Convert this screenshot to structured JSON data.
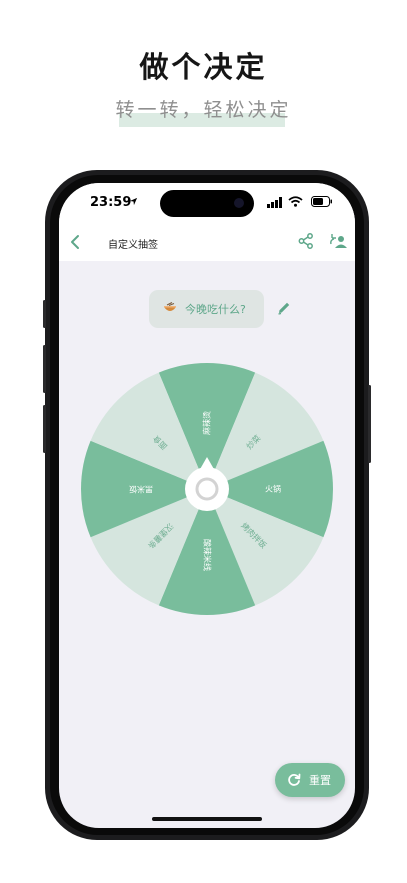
{
  "promo": {
    "headline": "做个决定",
    "subline": "转一转，轻松决定"
  },
  "statusbar": {
    "time": "23:59"
  },
  "appbar": {
    "title": "自定义抽签"
  },
  "question": {
    "text": "今晚吃什么?"
  },
  "wheel": {
    "segments": [
      "麻辣烫",
      "炒菜",
      "火锅",
      "烤肉拌饭",
      "酸辣米线",
      "汉堡薯条",
      "黑米饭",
      "面食"
    ],
    "colors": {
      "dark": "#79bd9c",
      "light": "#d5e5de"
    }
  },
  "reset": {
    "label": "重置"
  },
  "colors": {
    "accent": "#79bd9c",
    "accent_text": "#5ea78a",
    "screen_bg": "#f1f0f6"
  }
}
